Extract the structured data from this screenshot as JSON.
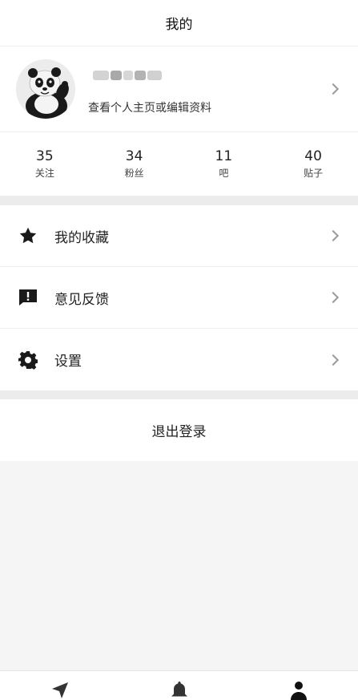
{
  "header": {
    "title": "我的"
  },
  "profile": {
    "subtitle": "查看个人主页或编辑资料"
  },
  "stats": [
    {
      "count": "35",
      "label": "关注"
    },
    {
      "count": "34",
      "label": "粉丝"
    },
    {
      "count": "11",
      "label": "吧"
    },
    {
      "count": "40",
      "label": "贴子"
    }
  ],
  "menu": [
    {
      "label": "我的收藏",
      "icon": "star-icon"
    },
    {
      "label": "意见反馈",
      "icon": "feedback-icon"
    },
    {
      "label": "设置",
      "icon": "gear-icon"
    }
  ],
  "logout": {
    "label": "退出登录"
  },
  "tabbar": [
    {
      "icon": "navigation-arrow-icon"
    },
    {
      "icon": "bell-icon"
    },
    {
      "icon": "person-icon",
      "active": true
    }
  ]
}
